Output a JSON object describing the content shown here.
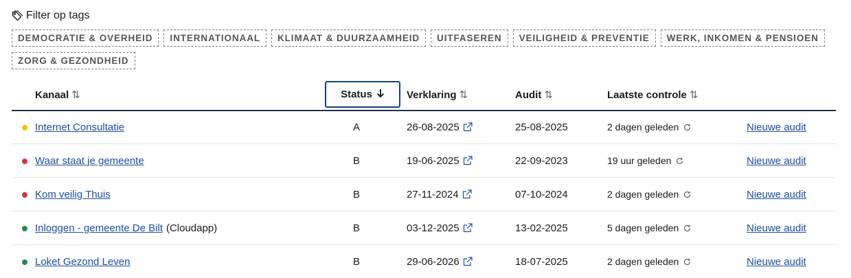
{
  "filter": {
    "label": "Filter op tags",
    "tags": [
      "DEMOCRATIE & OVERHEID",
      "INTERNATIONAAL",
      "KLIMAAT & DUURZAAMHEID",
      "UITFASEREN",
      "VEILIGHEID & PREVENTIE",
      "WERK, INKOMEN & PENSIOEN",
      "ZORG & GEZONDHEID"
    ]
  },
  "table": {
    "headers": {
      "kanaal": "Kanaal",
      "status": "Status",
      "verklaring": "Verklaring",
      "audit": "Audit",
      "laatste_controle": "Laatste controle"
    },
    "rows": [
      {
        "status_color": "#f2c200",
        "kanaal": "Internet Consultatie",
        "suffix": "",
        "status": "A",
        "verklaring": "26-08-2025",
        "audit": "25-08-2025",
        "laatste_controle": "2 dagen geleden",
        "action": "Nieuwe audit"
      },
      {
        "status_color": "#d9313f",
        "kanaal": "Waar staat je gemeente",
        "suffix": "",
        "status": "B",
        "verklaring": "19-06-2025",
        "audit": "22-09-2023",
        "laatste_controle": "19 uur geleden",
        "action": "Nieuwe audit"
      },
      {
        "status_color": "#d9313f",
        "kanaal": "Kom veilig Thuis",
        "suffix": "",
        "status": "B",
        "verklaring": "27-11-2024",
        "audit": "07-10-2024",
        "laatste_controle": "2 dagen geleden",
        "action": "Nieuwe audit"
      },
      {
        "status_color": "#1f8a4c",
        "kanaal": "Inloggen - gemeente De Bilt",
        "suffix": "(Cloudapp)",
        "status": "B",
        "verklaring": "03-12-2025",
        "audit": "13-02-2025",
        "laatste_controle": "5 dagen geleden",
        "action": "Nieuwe audit"
      },
      {
        "status_color": "#1f8a4c",
        "kanaal": "Loket Gezond Leven",
        "suffix": "",
        "status": "B",
        "verklaring": "29-06-2026",
        "audit": "18-07-2025",
        "laatste_controle": "2 dagen geleden",
        "action": "Nieuwe audit"
      }
    ]
  },
  "icons": {
    "filter": "tag-icon",
    "sort": "sort-icon",
    "sort_active": "arrow-down-icon",
    "external": "external-link-icon",
    "refresh": "refresh-icon"
  },
  "colors": {
    "link": "#1a4fa0",
    "header_border": "#1c2f4c",
    "status_focus": "#154273"
  }
}
